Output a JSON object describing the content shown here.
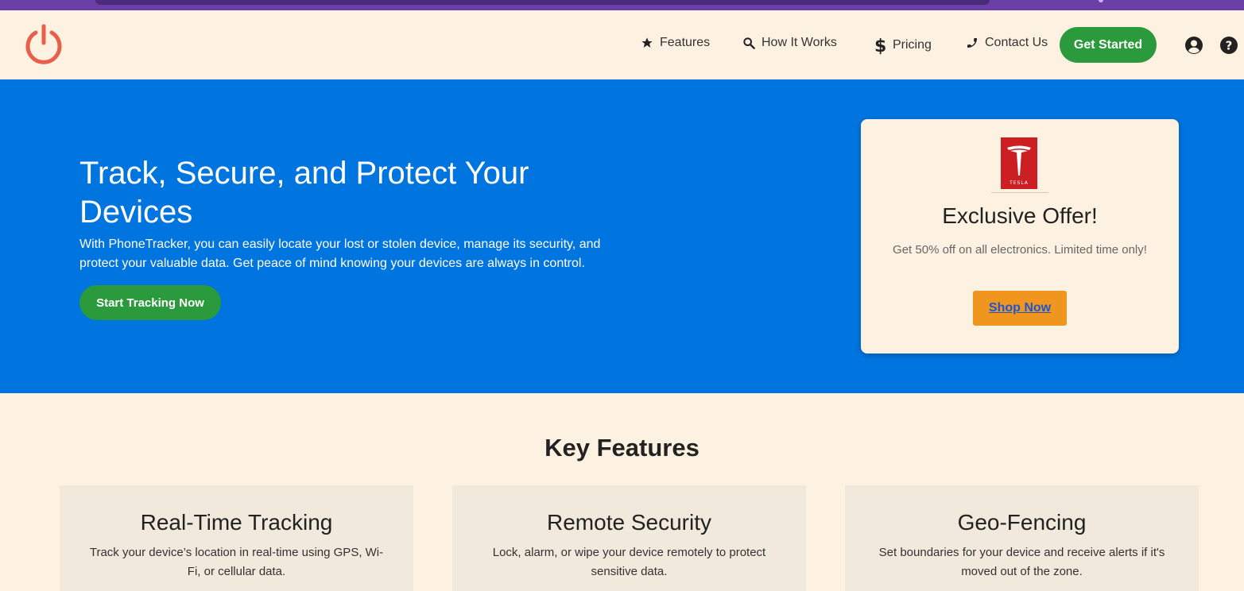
{
  "header": {
    "nav": [
      {
        "label": "Features",
        "icon": "star-icon"
      },
      {
        "label": "How It Works",
        "icon": "search-icon"
      },
      {
        "label": "Pricing",
        "icon": "dollar-icon"
      },
      {
        "label": "Contact Us",
        "icon": "phone-icon"
      }
    ],
    "cta_label": "Get Started"
  },
  "hero": {
    "title": "Track, Secure, and Protect Your Devices",
    "description": "With PhoneTracker, you can easily locate your lost or stolen device, manage its security, and protect your valuable data. Get peace of mind knowing your devices are always in control.",
    "cta_label": "Start Tracking Now"
  },
  "offer": {
    "logo_text": "TESLA",
    "title": "Exclusive Offer!",
    "description": "Get 50% off on all electronics. Limited time only!",
    "cta_label": "Shop Now"
  },
  "features": {
    "title": "Key Features",
    "items": [
      {
        "title": "Real-Time Tracking",
        "description": "Track your device’s location in real-time using GPS, Wi-Fi, or cellular data."
      },
      {
        "title": "Remote Security",
        "description": "Lock, alarm, or wipe your device remotely to protect sensitive data."
      },
      {
        "title": "Geo-Fencing",
        "description": "Set boundaries for your device and receive alerts if it's moved out of the zone."
      }
    ]
  },
  "colors": {
    "hero_bg": "#0075e0",
    "cta_green": "#2a9a3c",
    "shop_orange": "#f0951e",
    "page_bg": "#fdf2e1",
    "logo_red": "#e8604a"
  }
}
